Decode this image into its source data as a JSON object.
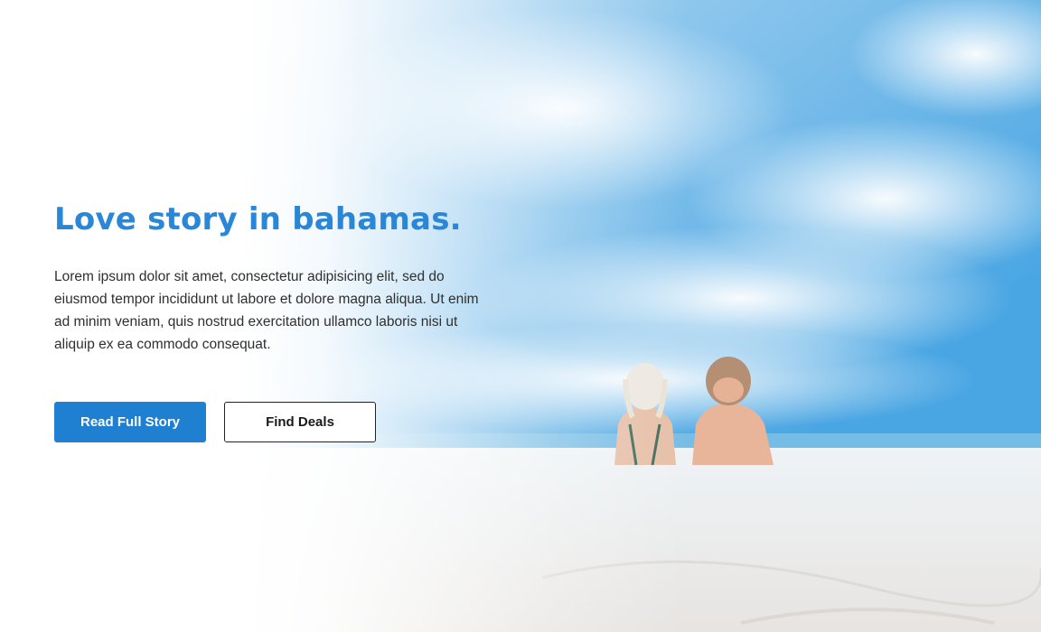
{
  "hero": {
    "title": "Love story in bahamas.",
    "description": "Lorem ipsum dolor sit amet, consectetur adipisicing elit, sed do eiusmod tempor incididunt ut labore et dolore magna aliqua. Ut enim ad minim veniam, quis nostrud exercitation ullamco laboris nisi ut aliquip ex ea commodo consequat.",
    "primary_button": "Read Full Story",
    "secondary_button": "Find Deals"
  },
  "colors": {
    "accent": "#1f7fd0",
    "title": "#2a86d6",
    "sky": "#5fb0e4",
    "sand": "#f4f4f4"
  }
}
